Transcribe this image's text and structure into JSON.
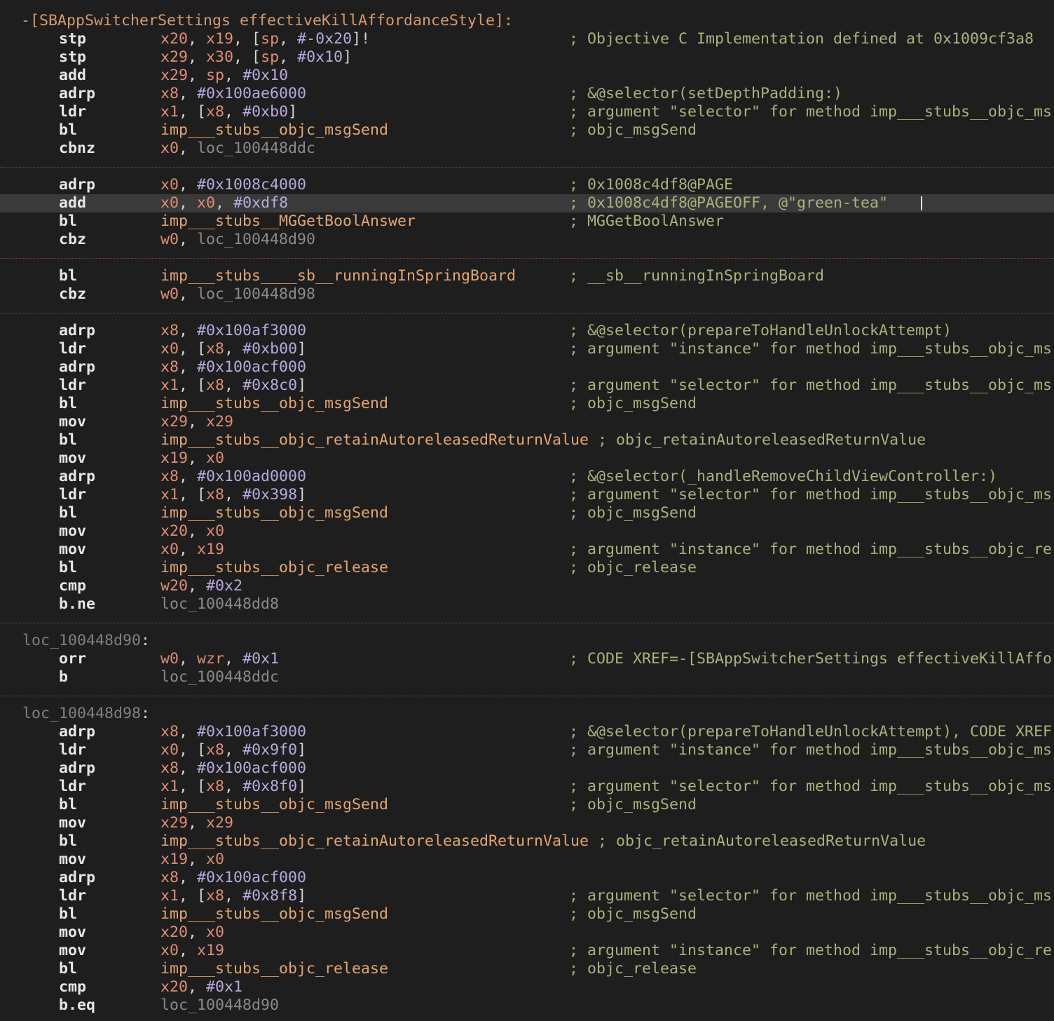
{
  "rows": [
    {
      "kind": "proc",
      "text": "-[SBAppSwitcherSettings effectiveKillAffordanceStyle]:"
    },
    {
      "kind": "ins",
      "m": "stp",
      "ops": [
        [
          "x20",
          "reg"
        ],
        [
          ", ",
          "punc"
        ],
        [
          "x19",
          "reg"
        ],
        [
          ", [",
          "punc"
        ],
        [
          "sp",
          "reg"
        ],
        [
          ", ",
          "punc"
        ],
        [
          "#-0x20",
          "num"
        ],
        [
          "]!",
          "punc"
        ]
      ],
      "c": "; Objective C Implementation defined at 0x1009cf3a8"
    },
    {
      "kind": "ins",
      "m": "stp",
      "ops": [
        [
          "x29",
          "reg"
        ],
        [
          ", ",
          "punc"
        ],
        [
          "x30",
          "reg"
        ],
        [
          ", [",
          "punc"
        ],
        [
          "sp",
          "reg"
        ],
        [
          ", ",
          "punc"
        ],
        [
          "#0x10",
          "num"
        ],
        [
          "]",
          "punc"
        ]
      ],
      "c": ""
    },
    {
      "kind": "ins",
      "m": "add",
      "ops": [
        [
          "x29",
          "reg"
        ],
        [
          ", ",
          "punc"
        ],
        [
          "sp",
          "reg"
        ],
        [
          ", ",
          "punc"
        ],
        [
          "#0x10",
          "num"
        ]
      ],
      "c": ""
    },
    {
      "kind": "ins",
      "m": "adrp",
      "ops": [
        [
          "x8",
          "reg"
        ],
        [
          ", ",
          "punc"
        ],
        [
          "#0x100ae6000",
          "num"
        ]
      ],
      "c": "; &@selector(setDepthPadding:)"
    },
    {
      "kind": "ins",
      "m": "ldr",
      "ops": [
        [
          "x1",
          "reg"
        ],
        [
          ", [",
          "punc"
        ],
        [
          "x8",
          "reg"
        ],
        [
          ", ",
          "punc"
        ],
        [
          "#0xb0",
          "num"
        ],
        [
          "]",
          "punc"
        ]
      ],
      "c": "; argument \"selector\" for method imp___stubs__objc_ms"
    },
    {
      "kind": "ins",
      "m": "bl",
      "ops": [
        [
          "imp___stubs__objc_msgSend",
          "sym"
        ]
      ],
      "c": "; objc_msgSend"
    },
    {
      "kind": "ins",
      "m": "cbnz",
      "ops": [
        [
          "x0",
          "reg"
        ],
        [
          ", ",
          "punc"
        ],
        [
          "loc_100448ddc",
          "lbl"
        ]
      ],
      "c": ""
    },
    {
      "kind": "sep"
    },
    {
      "kind": "ins",
      "m": "adrp",
      "ops": [
        [
          "x0",
          "reg"
        ],
        [
          ", ",
          "punc"
        ],
        [
          "#0x1008c4000",
          "num"
        ]
      ],
      "c": "; 0x1008c4df8@PAGE"
    },
    {
      "kind": "ins",
      "m": "add",
      "ops": [
        [
          "x0",
          "reg"
        ],
        [
          ", ",
          "punc"
        ],
        [
          "x0",
          "reg"
        ],
        [
          ", ",
          "punc"
        ],
        [
          "#0xdf8",
          "num"
        ]
      ],
      "c": "; 0x1008c4df8@PAGEOFF, @\"green-tea\"",
      "selected": true
    },
    {
      "kind": "ins",
      "m": "bl",
      "ops": [
        [
          "imp___stubs__MGGetBoolAnswer",
          "sym"
        ]
      ],
      "c": "; MGGetBoolAnswer"
    },
    {
      "kind": "ins",
      "m": "cbz",
      "ops": [
        [
          "w0",
          "reg"
        ],
        [
          ", ",
          "punc"
        ],
        [
          "loc_100448d90",
          "lbl"
        ]
      ],
      "c": ""
    },
    {
      "kind": "sep"
    },
    {
      "kind": "ins",
      "m": "bl",
      "ops": [
        [
          "imp___stubs____sb__runningInSpringBoard",
          "sym"
        ]
      ],
      "c": "; __sb__runningInSpringBoard"
    },
    {
      "kind": "ins",
      "m": "cbz",
      "ops": [
        [
          "w0",
          "reg"
        ],
        [
          ", ",
          "punc"
        ],
        [
          "loc_100448d98",
          "lbl"
        ]
      ],
      "c": ""
    },
    {
      "kind": "sep"
    },
    {
      "kind": "ins",
      "m": "adrp",
      "ops": [
        [
          "x8",
          "reg"
        ],
        [
          ", ",
          "punc"
        ],
        [
          "#0x100af3000",
          "num"
        ]
      ],
      "c": "; &@selector(prepareToHandleUnlockAttempt)"
    },
    {
      "kind": "ins",
      "m": "ldr",
      "ops": [
        [
          "x0",
          "reg"
        ],
        [
          ", [",
          "punc"
        ],
        [
          "x8",
          "reg"
        ],
        [
          ", ",
          "punc"
        ],
        [
          "#0xb00",
          "num"
        ],
        [
          "]",
          "punc"
        ]
      ],
      "c": "; argument \"instance\" for method imp___stubs__objc_ms"
    },
    {
      "kind": "ins",
      "m": "adrp",
      "ops": [
        [
          "x8",
          "reg"
        ],
        [
          ", ",
          "punc"
        ],
        [
          "#0x100acf000",
          "num"
        ]
      ],
      "c": ""
    },
    {
      "kind": "ins",
      "m": "ldr",
      "ops": [
        [
          "x1",
          "reg"
        ],
        [
          ", [",
          "punc"
        ],
        [
          "x8",
          "reg"
        ],
        [
          ", ",
          "punc"
        ],
        [
          "#0x8c0",
          "num"
        ],
        [
          "]",
          "punc"
        ]
      ],
      "c": "; argument \"selector\" for method imp___stubs__objc_ms"
    },
    {
      "kind": "ins",
      "m": "bl",
      "ops": [
        [
          "imp___stubs__objc_msgSend",
          "sym"
        ]
      ],
      "c": "; objc_msgSend"
    },
    {
      "kind": "ins",
      "m": "mov",
      "ops": [
        [
          "x29",
          "reg"
        ],
        [
          ", ",
          "punc"
        ],
        [
          "x29",
          "reg"
        ]
      ],
      "c": ""
    },
    {
      "kind": "ins",
      "m": "bl",
      "ops": [
        [
          "imp___stubs__objc_retainAutoreleasedReturnValue",
          "sym"
        ]
      ],
      "c": "; objc_retainAutoreleasedReturnValue",
      "inline_comment": true
    },
    {
      "kind": "ins",
      "m": "mov",
      "ops": [
        [
          "x19",
          "reg"
        ],
        [
          ", ",
          "punc"
        ],
        [
          "x0",
          "reg"
        ]
      ],
      "c": ""
    },
    {
      "kind": "ins",
      "m": "adrp",
      "ops": [
        [
          "x8",
          "reg"
        ],
        [
          ", ",
          "punc"
        ],
        [
          "#0x100ad0000",
          "num"
        ]
      ],
      "c": "; &@selector(_handleRemoveChildViewController:)"
    },
    {
      "kind": "ins",
      "m": "ldr",
      "ops": [
        [
          "x1",
          "reg"
        ],
        [
          ", [",
          "punc"
        ],
        [
          "x8",
          "reg"
        ],
        [
          ", ",
          "punc"
        ],
        [
          "#0x398",
          "num"
        ],
        [
          "]",
          "punc"
        ]
      ],
      "c": "; argument \"selector\" for method imp___stubs__objc_ms"
    },
    {
      "kind": "ins",
      "m": "bl",
      "ops": [
        [
          "imp___stubs__objc_msgSend",
          "sym"
        ]
      ],
      "c": "; objc_msgSend"
    },
    {
      "kind": "ins",
      "m": "mov",
      "ops": [
        [
          "x20",
          "reg"
        ],
        [
          ", ",
          "punc"
        ],
        [
          "x0",
          "reg"
        ]
      ],
      "c": ""
    },
    {
      "kind": "ins",
      "m": "mov",
      "ops": [
        [
          "x0",
          "reg"
        ],
        [
          ", ",
          "punc"
        ],
        [
          "x19",
          "reg"
        ]
      ],
      "c": "; argument \"instance\" for method imp___stubs__objc_re"
    },
    {
      "kind": "ins",
      "m": "bl",
      "ops": [
        [
          "imp___stubs__objc_release",
          "sym"
        ]
      ],
      "c": "; objc_release"
    },
    {
      "kind": "ins",
      "m": "cmp",
      "ops": [
        [
          "w20",
          "reg"
        ],
        [
          ", ",
          "punc"
        ],
        [
          "#0x2",
          "num"
        ]
      ],
      "c": ""
    },
    {
      "kind": "ins",
      "m": "b.ne",
      "ops": [
        [
          "loc_100448dd8",
          "lbl"
        ]
      ],
      "c": ""
    },
    {
      "kind": "sep"
    },
    {
      "kind": "label",
      "text": "loc_100448d90"
    },
    {
      "kind": "ins",
      "m": "orr",
      "ops": [
        [
          "w0",
          "reg"
        ],
        [
          ", ",
          "punc"
        ],
        [
          "wzr",
          "reg"
        ],
        [
          ", ",
          "punc"
        ],
        [
          "#0x1",
          "num"
        ]
      ],
      "c": "; CODE XREF=-[SBAppSwitcherSettings effectiveKillAffo"
    },
    {
      "kind": "ins",
      "m": "b",
      "ops": [
        [
          "loc_100448ddc",
          "lbl"
        ]
      ],
      "c": ""
    },
    {
      "kind": "sep"
    },
    {
      "kind": "label",
      "text": "loc_100448d98"
    },
    {
      "kind": "ins",
      "m": "adrp",
      "ops": [
        [
          "x8",
          "reg"
        ],
        [
          ", ",
          "punc"
        ],
        [
          "#0x100af3000",
          "num"
        ]
      ],
      "c": "; &@selector(prepareToHandleUnlockAttempt), CODE XREF"
    },
    {
      "kind": "ins",
      "m": "ldr",
      "ops": [
        [
          "x0",
          "reg"
        ],
        [
          ", [",
          "punc"
        ],
        [
          "x8",
          "reg"
        ],
        [
          ", ",
          "punc"
        ],
        [
          "#0x9f0",
          "num"
        ],
        [
          "]",
          "punc"
        ]
      ],
      "c": "; argument \"instance\" for method imp___stubs__objc_ms"
    },
    {
      "kind": "ins",
      "m": "adrp",
      "ops": [
        [
          "x8",
          "reg"
        ],
        [
          ", ",
          "punc"
        ],
        [
          "#0x100acf000",
          "num"
        ]
      ],
      "c": ""
    },
    {
      "kind": "ins",
      "m": "ldr",
      "ops": [
        [
          "x1",
          "reg"
        ],
        [
          ", [",
          "punc"
        ],
        [
          "x8",
          "reg"
        ],
        [
          ", ",
          "punc"
        ],
        [
          "#0x8f0",
          "num"
        ],
        [
          "]",
          "punc"
        ]
      ],
      "c": "; argument \"selector\" for method imp___stubs__objc_ms"
    },
    {
      "kind": "ins",
      "m": "bl",
      "ops": [
        [
          "imp___stubs__objc_msgSend",
          "sym"
        ]
      ],
      "c": "; objc_msgSend"
    },
    {
      "kind": "ins",
      "m": "mov",
      "ops": [
        [
          "x29",
          "reg"
        ],
        [
          ", ",
          "punc"
        ],
        [
          "x29",
          "reg"
        ]
      ],
      "c": ""
    },
    {
      "kind": "ins",
      "m": "bl",
      "ops": [
        [
          "imp___stubs__objc_retainAutoreleasedReturnValue",
          "sym"
        ]
      ],
      "c": "; objc_retainAutoreleasedReturnValue",
      "inline_comment": true
    },
    {
      "kind": "ins",
      "m": "mov",
      "ops": [
        [
          "x19",
          "reg"
        ],
        [
          ", ",
          "punc"
        ],
        [
          "x0",
          "reg"
        ]
      ],
      "c": ""
    },
    {
      "kind": "ins",
      "m": "adrp",
      "ops": [
        [
          "x8",
          "reg"
        ],
        [
          ", ",
          "punc"
        ],
        [
          "#0x100acf000",
          "num"
        ]
      ],
      "c": ""
    },
    {
      "kind": "ins",
      "m": "ldr",
      "ops": [
        [
          "x1",
          "reg"
        ],
        [
          ", [",
          "punc"
        ],
        [
          "x8",
          "reg"
        ],
        [
          ", ",
          "punc"
        ],
        [
          "#0x8f8",
          "num"
        ],
        [
          "]",
          "punc"
        ]
      ],
      "c": "; argument \"selector\" for method imp___stubs__objc_ms"
    },
    {
      "kind": "ins",
      "m": "bl",
      "ops": [
        [
          "imp___stubs__objc_msgSend",
          "sym"
        ]
      ],
      "c": "; objc_msgSend"
    },
    {
      "kind": "ins",
      "m": "mov",
      "ops": [
        [
          "x20",
          "reg"
        ],
        [
          ", ",
          "punc"
        ],
        [
          "x0",
          "reg"
        ]
      ],
      "c": ""
    },
    {
      "kind": "ins",
      "m": "mov",
      "ops": [
        [
          "x0",
          "reg"
        ],
        [
          ", ",
          "punc"
        ],
        [
          "x19",
          "reg"
        ]
      ],
      "c": "; argument \"instance\" for method imp___stubs__objc_re"
    },
    {
      "kind": "ins",
      "m": "bl",
      "ops": [
        [
          "imp___stubs__objc_release",
          "sym"
        ]
      ],
      "c": "; objc_release"
    },
    {
      "kind": "ins",
      "m": "cmp",
      "ops": [
        [
          "x20",
          "reg"
        ],
        [
          ", ",
          "punc"
        ],
        [
          "#0x1",
          "num"
        ]
      ],
      "c": ""
    },
    {
      "kind": "ins",
      "m": "b.eq",
      "ops": [
        [
          "loc_100448d90",
          "lbl"
        ]
      ],
      "c": ""
    }
  ]
}
